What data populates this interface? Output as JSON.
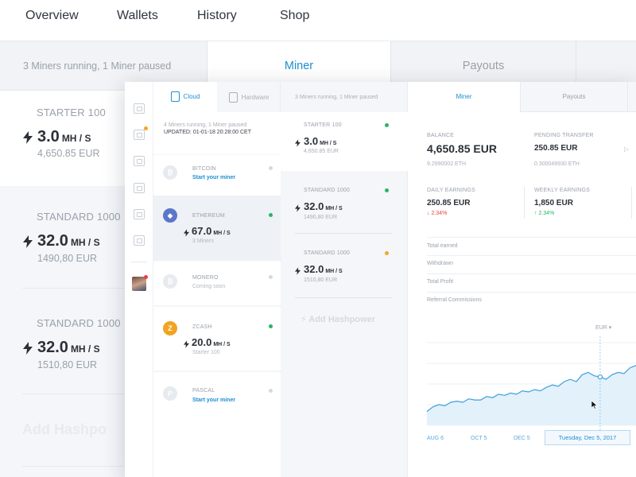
{
  "topnav": {
    "items": [
      "Overview",
      "Wallets",
      "History",
      "Shop"
    ]
  },
  "background": {
    "status": "3 Miners running, 1 Miner paused",
    "tabs": [
      "Miner",
      "Payouts"
    ],
    "miners": [
      {
        "title": "STARTER 100",
        "rate": "3.0",
        "unit": "MH / S",
        "eur": "4,650.85 EUR"
      },
      {
        "title": "STANDARD 1000",
        "rate": "32.0",
        "unit": "MH / S",
        "eur": "1490,80 EUR"
      },
      {
        "title": "STANDARD 1000",
        "rate": "32.0",
        "unit": "MH / S",
        "eur": "1510,80 EUR"
      }
    ],
    "add": "Add Hashpo"
  },
  "sidebar_tabs": {
    "cloud": "Cloud",
    "hardware": "Hardware"
  },
  "coin_status": {
    "line1": "4 Miners running, 1 Miner paused",
    "line2": "UPDATED: 01-01-18 20:28:00 CET"
  },
  "coins": [
    {
      "name": "BITCOIN",
      "link": "Start your miner",
      "icon": "bitcoin-icon"
    },
    {
      "name": "ETHEREUM",
      "rate": "67.0",
      "unit": "MH / S",
      "sub": "3 Miners",
      "icon": "ethereum-icon"
    },
    {
      "name": "MONERO",
      "sub": "Coming soon",
      "icon": "monero-icon"
    },
    {
      "name": "ZCASH",
      "rate": "20.0",
      "unit": "MH / S",
      "sub": "Starter 100",
      "icon": "zcash-icon"
    },
    {
      "name": "PASCAL",
      "link": "Start your miner",
      "icon": "pascal-icon"
    }
  ],
  "miners_panel": {
    "header": "3 Miners running, 1 Miner paused",
    "cards": [
      {
        "title": "STARTER 100",
        "rate": "3.0",
        "unit": "MH / S",
        "eur": "4,650.85 EUR"
      },
      {
        "title": "STANDARD 1000",
        "rate": "32.0",
        "unit": "MH / S",
        "eur": "1490,80 EUR"
      },
      {
        "title": "STANDARD 1000",
        "rate": "32.0",
        "unit": "MH / S",
        "eur": "1510,80 EUR"
      }
    ],
    "add": "Add Hashpower"
  },
  "main_tabs": [
    "Miner",
    "Payouts"
  ],
  "stats": {
    "balance": {
      "label": "BALANCE",
      "value": "4,650.85 EUR",
      "sub": "9.2990002 ETH"
    },
    "pending": {
      "label": "PENDING TRANSFER",
      "value": "250.85 EUR",
      "sub": "0.300049930 ETH"
    },
    "daily": {
      "label": "DAILY EARNINGS",
      "value": "250.85 EUR",
      "change": "2.34%"
    },
    "weekly": {
      "label": "WEEKLY EARNINGS",
      "value": "1,850 EUR",
      "change": "2.34%"
    }
  },
  "rows": [
    "Total earned",
    "Withdrawn",
    "Total Profit",
    "Referral Commissions"
  ],
  "currency": "EUR",
  "chart_data": {
    "type": "area",
    "x_labels": [
      "AUG 6",
      "OCT 5",
      "DEC 5"
    ],
    "highlight_label": "Tuesday, Dec 5, 2017",
    "values": [
      12,
      16,
      18,
      17,
      20,
      21,
      20,
      23,
      22,
      22,
      25,
      24,
      27,
      26,
      28,
      27,
      30,
      29,
      31,
      30,
      33,
      35,
      34,
      38,
      40,
      38,
      44,
      46,
      43,
      42,
      40,
      44,
      46,
      45,
      50,
      52
    ],
    "highlight_index": 29,
    "line_color": "#3ea0dd",
    "fill_color": "#e3f1fb"
  }
}
